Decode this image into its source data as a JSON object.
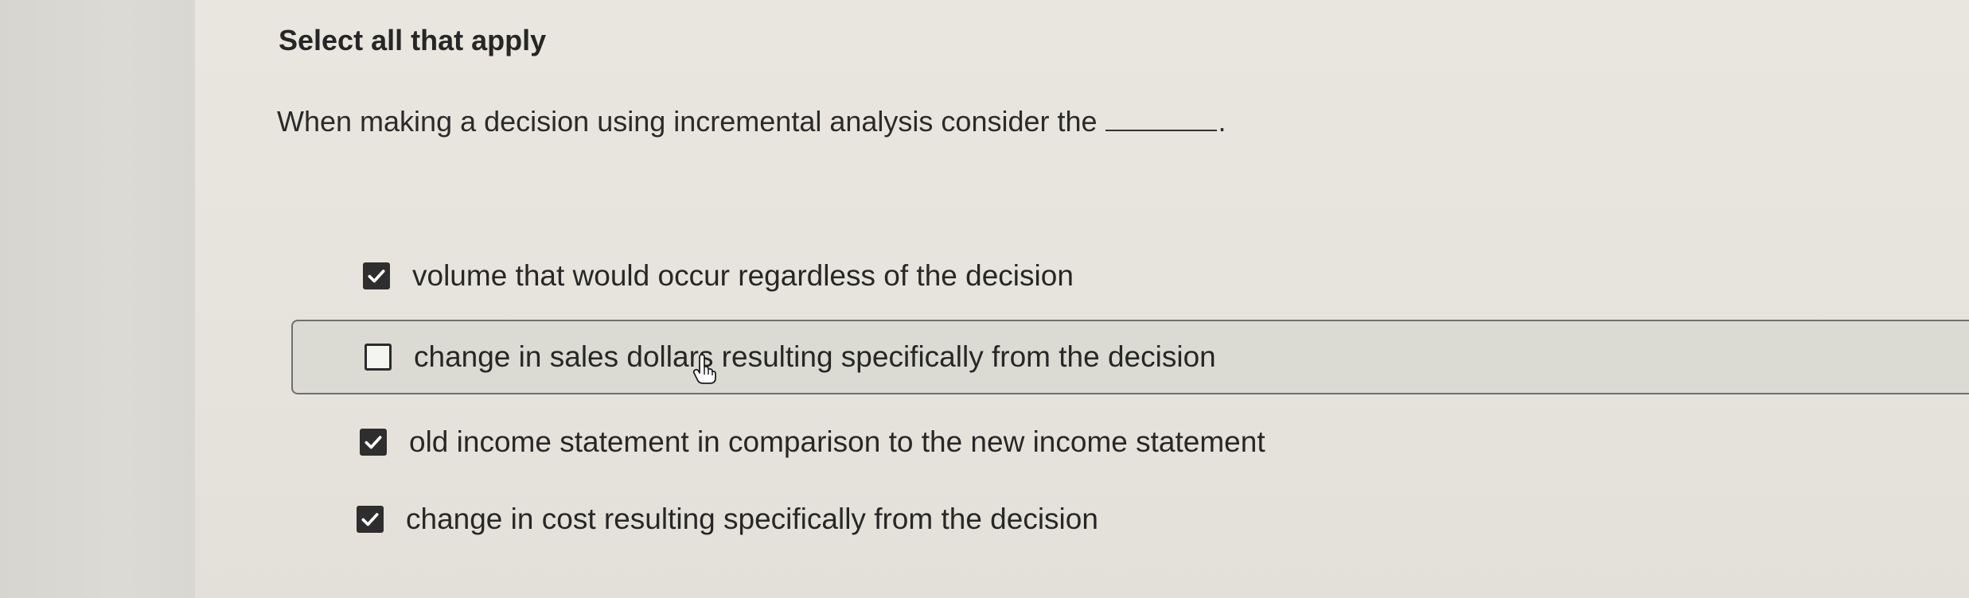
{
  "instruction": "Select all that apply",
  "question": {
    "text": "When making a decision using incremental analysis consider the",
    "end": "."
  },
  "options": [
    {
      "label": "volume that would occur regardless of the decision",
      "checked": true
    },
    {
      "label": "change in sales dollars resulting specifically from the decision",
      "checked": false
    },
    {
      "label": "old income statement in comparison to the new income statement",
      "checked": true
    },
    {
      "label": "change in cost resulting specifically from the decision",
      "checked": true
    }
  ],
  "icons": {
    "check": "check-icon",
    "cursor": "hand-pointer-icon"
  }
}
